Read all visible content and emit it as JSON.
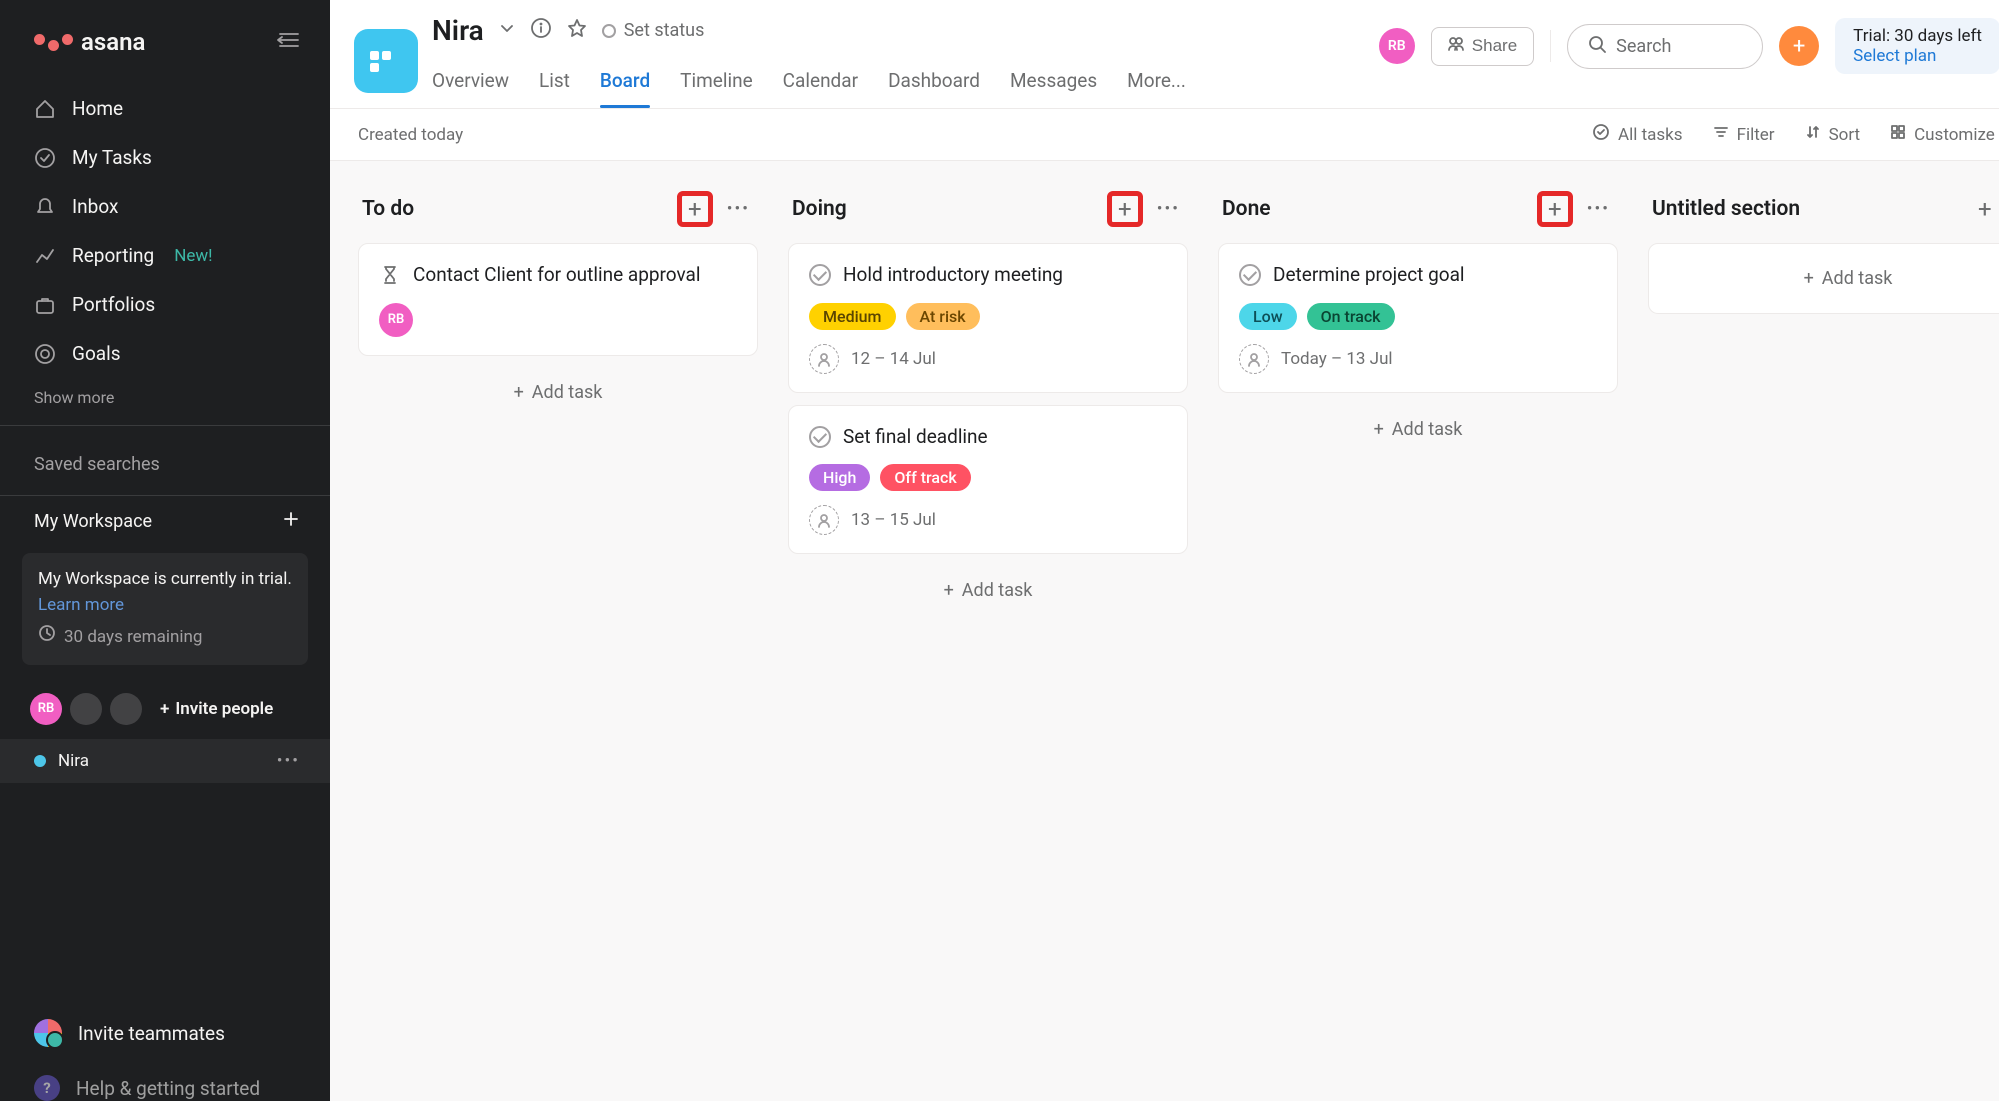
{
  "brand": "asana",
  "sidebar": {
    "nav": [
      {
        "label": "Home"
      },
      {
        "label": "My Tasks"
      },
      {
        "label": "Inbox"
      },
      {
        "label": "Reporting",
        "badge": "New!"
      },
      {
        "label": "Portfolios"
      },
      {
        "label": "Goals"
      }
    ],
    "show_more": "Show more",
    "saved_searches": "Saved searches",
    "workspace": "My Workspace",
    "trial_text_1": "My Workspace is currently in trial.",
    "trial_learn_more": "Learn more",
    "trial_remaining": "30 days remaining",
    "member_initials": "RB",
    "invite_people": "Invite people",
    "project_name": "Nira",
    "invite_teammates": "Invite teammates",
    "help": "Help & getting started"
  },
  "header": {
    "project_title": "Nira",
    "set_status": "Set status",
    "share": "Share",
    "search_placeholder": "Search",
    "trial_line1": "Trial: 30 days left",
    "trial_line2": "Select plan",
    "member_initials": "RB",
    "tabs": [
      {
        "label": "Overview"
      },
      {
        "label": "List"
      },
      {
        "label": "Board",
        "active": true
      },
      {
        "label": "Timeline"
      },
      {
        "label": "Calendar"
      },
      {
        "label": "Dashboard"
      },
      {
        "label": "Messages"
      },
      {
        "label": "More..."
      }
    ]
  },
  "toolbar": {
    "created": "Created today",
    "all_tasks": "All tasks",
    "filter": "Filter",
    "sort": "Sort",
    "customize": "Customize"
  },
  "board": {
    "add_task": "Add task",
    "columns": [
      {
        "title": "To do",
        "highlight_add": true,
        "cards": [
          {
            "icon": "hourglass",
            "title": "Contact Client for outline approval",
            "assignee": "RB"
          }
        ]
      },
      {
        "title": "Doing",
        "highlight_add": true,
        "cards": [
          {
            "icon": "check",
            "title": "Hold introductory meeting",
            "pills": [
              {
                "label": "Medium",
                "cls": "p-medium"
              },
              {
                "label": "At risk",
                "cls": "p-atrisk"
              }
            ],
            "dates": "12 – 14 Jul"
          },
          {
            "icon": "check",
            "title": "Set final deadline",
            "pills": [
              {
                "label": "High",
                "cls": "p-high"
              },
              {
                "label": "Off track",
                "cls": "p-off"
              }
            ],
            "dates": "13 – 15 Jul"
          }
        ]
      },
      {
        "title": "Done",
        "highlight_add": true,
        "cards": [
          {
            "icon": "check",
            "title": "Determine project goal",
            "pills": [
              {
                "label": "Low",
                "cls": "p-low"
              },
              {
                "label": "On track",
                "cls": "p-ontrack"
              }
            ],
            "dates": "Today – 13 Jul"
          }
        ]
      },
      {
        "title": "Untitled section",
        "untitled": true
      }
    ]
  }
}
